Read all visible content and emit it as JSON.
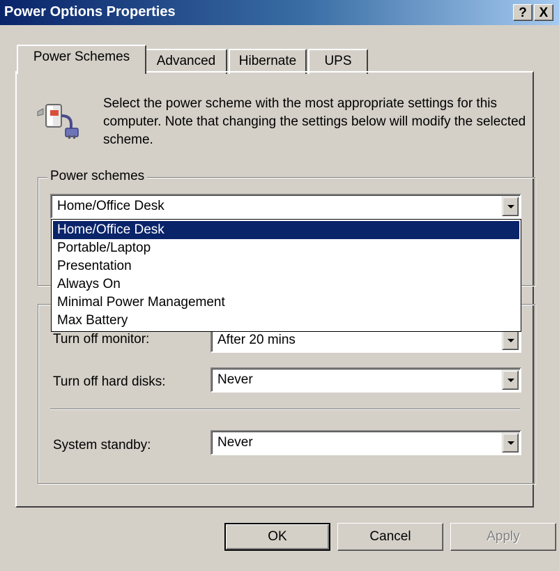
{
  "window": {
    "title": "Power Options Properties",
    "help_label": "?",
    "close_label": "X"
  },
  "tabs": [
    {
      "label": "Power Schemes",
      "active": true
    },
    {
      "label": "Advanced",
      "active": false
    },
    {
      "label": "Hibernate",
      "active": false
    },
    {
      "label": "UPS",
      "active": false
    }
  ],
  "intro": {
    "icon": "power-plug-icon",
    "text": "Select the power scheme with the most appropriate settings for this computer. Note that changing the settings below will modify the selected scheme."
  },
  "power_schemes": {
    "group_label": "Power schemes",
    "selected": "Home/Office Desk",
    "options": [
      "Home/Office Desk",
      "Portable/Laptop",
      "Presentation",
      "Always On",
      "Minimal Power Management",
      "Max Battery"
    ]
  },
  "settings": {
    "monitor": {
      "label": "Turn off monitor:",
      "value": "After 20 mins"
    },
    "hard_disks": {
      "label": "Turn off hard disks:",
      "value": "Never"
    },
    "standby": {
      "label": "System standby:",
      "value": "Never"
    }
  },
  "buttons": {
    "ok": "OK",
    "cancel": "Cancel",
    "apply": "Apply"
  },
  "colors": {
    "titlebar_start": "#0a246a",
    "titlebar_end": "#a6caf0",
    "selection": "#0a246a",
    "face": "#d4d0c8"
  }
}
